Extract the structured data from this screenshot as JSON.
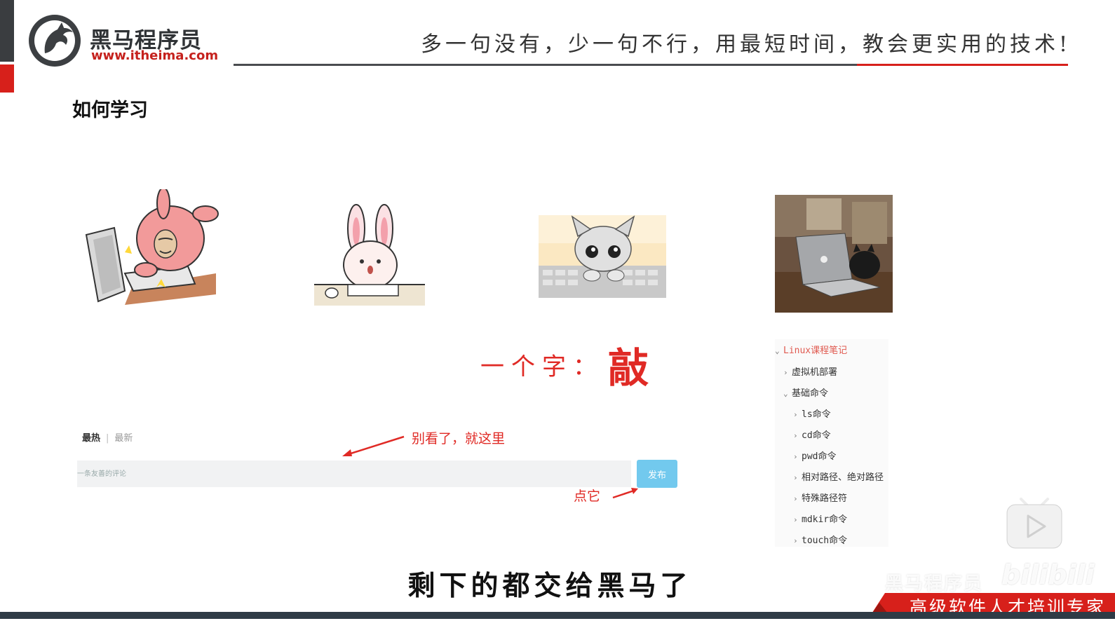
{
  "header": {
    "brand_name": "黑马程序员",
    "brand_url": "www.itheima.com",
    "slogan": "多一句没有，少一句不行，用最短时间，教会更实用的技术!"
  },
  "section_title": "如何学习",
  "phrase": {
    "prefix": "一个字：",
    "key": "敲"
  },
  "comment": {
    "tabs": [
      "最热",
      "最新"
    ],
    "tab_separator": "|",
    "placeholder": "一条友善的评论",
    "publish_label": "发布",
    "hint_top": "别看了，就这里",
    "hint_bottom": "点它"
  },
  "tree": {
    "root": "Linux课程笔记",
    "items": [
      {
        "label": "虚拟机部署",
        "chevron": "›"
      },
      {
        "label": "基础命令",
        "chevron": "⌄"
      },
      {
        "label": "ls命令",
        "chevron": "›"
      },
      {
        "label": "cd命令",
        "chevron": "›"
      },
      {
        "label": "pwd命令",
        "chevron": "›"
      },
      {
        "label": "相对路径、绝对路径",
        "chevron": "›"
      },
      {
        "label": "特殊路径符",
        "chevron": "›"
      },
      {
        "label": "mdkir命令",
        "chevron": "›"
      },
      {
        "label": "touch命令",
        "chevron": "›"
      }
    ],
    "root_chevron": "⌄"
  },
  "subtitle": "剩下的都交给黑马了",
  "footer": {
    "tagline": "高级软件人才培训专家",
    "watermark": "黑马程序员",
    "watermark_brand": "bilibili"
  },
  "colors": {
    "accent_red": "#d7201b",
    "dark_bar": "#3a3d40",
    "publish_blue": "#72c9ee"
  }
}
